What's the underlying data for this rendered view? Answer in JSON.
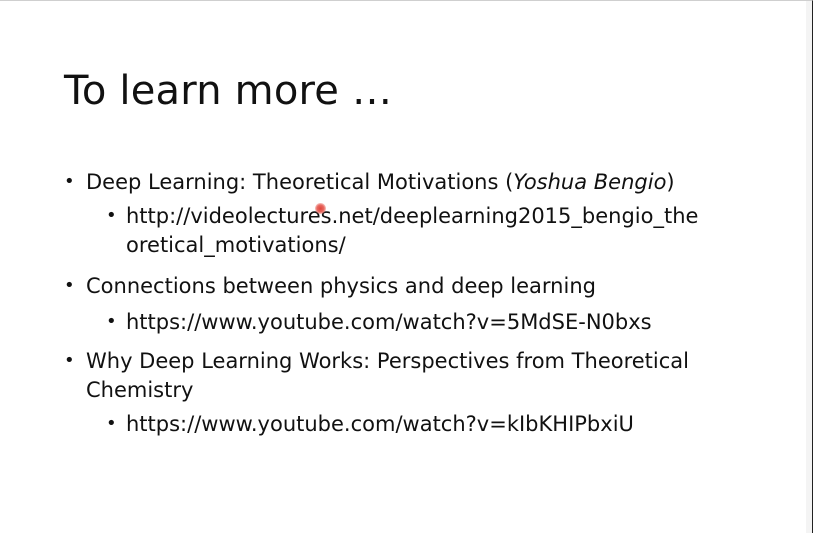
{
  "slide": {
    "title": "To learn more …",
    "items": [
      {
        "text_before": "Deep Learning: Theoretical Motivations (",
        "author": "Yoshua Bengio",
        "text_after": ")",
        "link_line1": "http://videolectures.net/deeplearning2015_bengio_the",
        "link_line2": "oretical_motivations/"
      },
      {
        "text": "Connections between physics and deep learning",
        "link": "https://www.youtube.com/watch?v=5MdSE-N0bxs"
      },
      {
        "text_line1": "Why Deep Learning Works: Perspectives from Theoretical",
        "text_line2": "Chemistry",
        "link": "https://www.youtube.com/watch?v=kIbKHIPbxiU"
      }
    ],
    "bullet_glyph": "•"
  }
}
